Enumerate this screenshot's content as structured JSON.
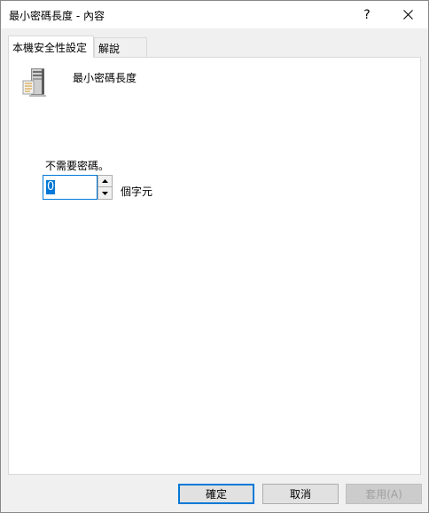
{
  "window": {
    "title": "最小密碼長度 - 內容",
    "help_label": "?",
    "close_icon": "close-icon"
  },
  "tabs": [
    {
      "label": "本機安全性設定",
      "active": true
    },
    {
      "label": "解說",
      "active": false
    }
  ],
  "policy": {
    "icon": "server-icon",
    "name": "最小密碼長度",
    "description": "不需要密碼。",
    "value": "0",
    "unit": "個字元"
  },
  "buttons": {
    "ok": "確定",
    "cancel": "取消",
    "apply": "套用(A)"
  },
  "colors": {
    "accent": "#0078d7",
    "dialog_bg": "#f0f0f0",
    "panel_bg": "#ffffff"
  }
}
